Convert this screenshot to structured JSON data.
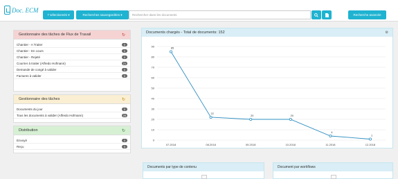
{
  "header": {
    "logo_text": "Doc. ECM",
    "selected_label": "7 sélectionnés ▾",
    "saved_searches_label": "Recherches sauvegardées ▾",
    "search_placeholder": "Rechercher dans les documents",
    "advanced_search_label": "Recherche avancée"
  },
  "workflow_panel": {
    "title": "Gestionnaire des tâches de Flux de Travail",
    "head_color": "#f6d3d3",
    "items": [
      {
        "label": "Chantier - A Traiter",
        "count": "0"
      },
      {
        "label": "Chantier - En cours",
        "count": "0"
      },
      {
        "label": "Chantier - Rejeté",
        "count": "0"
      },
      {
        "label": "Courrier à traiter (Alfredo Hofmann)",
        "count": "21"
      },
      {
        "label": "Demande de congé à valider",
        "count": "0"
      },
      {
        "label": "Factures à valider",
        "count": "0"
      }
    ]
  },
  "tasks_panel": {
    "title": "Gestionnaire des tâches",
    "head_color": "#fbefd3",
    "items": [
      {
        "label": "Documents du jour",
        "count": "0"
      },
      {
        "label": "Tous les documents à valider (Alfredo Hofmann)",
        "count": "25"
      }
    ]
  },
  "distribution_panel": {
    "title": "Distribution",
    "head_color": "#d6f0d3",
    "items": [
      {
        "label": "Envoyé",
        "count": "0"
      },
      {
        "label": "Reçu",
        "count": "0"
      }
    ]
  },
  "chart_panel": {
    "title": "Documents chargés - Total de documents: 152"
  },
  "chart_data": {
    "type": "line",
    "title": "Documents chargés - Total de documents: 152",
    "categories": [
      "07.2018",
      "08.2018",
      "09.2018",
      "10.2018",
      "11.2018",
      "12.2018"
    ],
    "values": [
      85,
      22,
      20,
      20,
      4,
      1
    ],
    "ylim": [
      0,
      90
    ],
    "yticks": [
      0,
      10,
      20,
      30,
      40,
      50,
      60,
      70,
      80,
      90
    ],
    "grid": true,
    "color": "#2f8fc1"
  },
  "bottom_panels": {
    "content_type_title": "Documents par type de contenu",
    "workflow_title": "Document par workflows"
  }
}
